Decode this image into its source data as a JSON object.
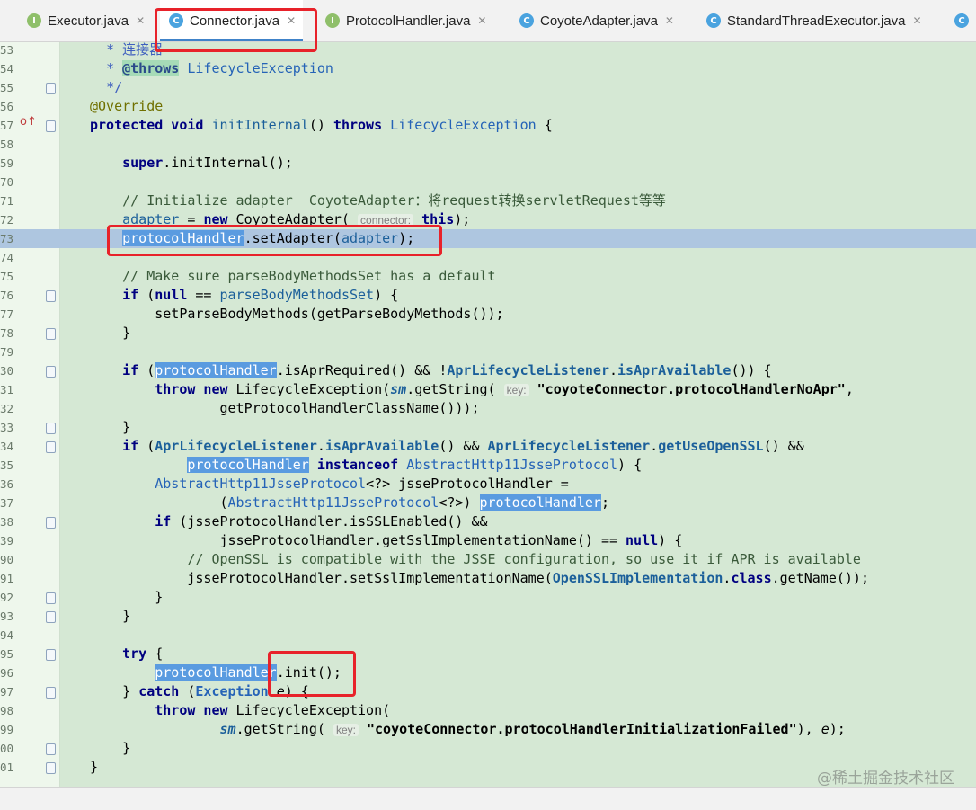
{
  "tabs": [
    {
      "label": "Executor.java",
      "kind": "I",
      "active": false
    },
    {
      "label": "Connector.java",
      "kind": "C",
      "active": true
    },
    {
      "label": "ProtocolHandler.java",
      "kind": "I",
      "active": false
    },
    {
      "label": "CoyoteAdapter.java",
      "kind": "C",
      "active": false
    },
    {
      "label": "StandardThreadExecutor.java",
      "kind": "C",
      "active": false
    }
  ],
  "line_numbers": [
    "53",
    "54",
    "55",
    "56",
    "57",
    "58",
    "59",
    "70",
    "71",
    "72",
    "73",
    "74",
    "75",
    "76",
    "77",
    "78",
    "79",
    "30",
    "31",
    "32",
    "33",
    "34",
    "35",
    "36",
    "37",
    "38",
    "39",
    "90",
    "91",
    "92",
    "93",
    "94",
    "95",
    "96",
    "97",
    "98",
    "99",
    "00",
    "01"
  ],
  "highlight_line": "73",
  "watermark": "@稀土掘金技术社区",
  "colors": {
    "editor_bg": "#d5e8d4",
    "selection": "#5a9be0",
    "current_line": "#aec6e0",
    "annotation_box": "#e8222a",
    "active_tab_underline": "#4083c9"
  }
}
